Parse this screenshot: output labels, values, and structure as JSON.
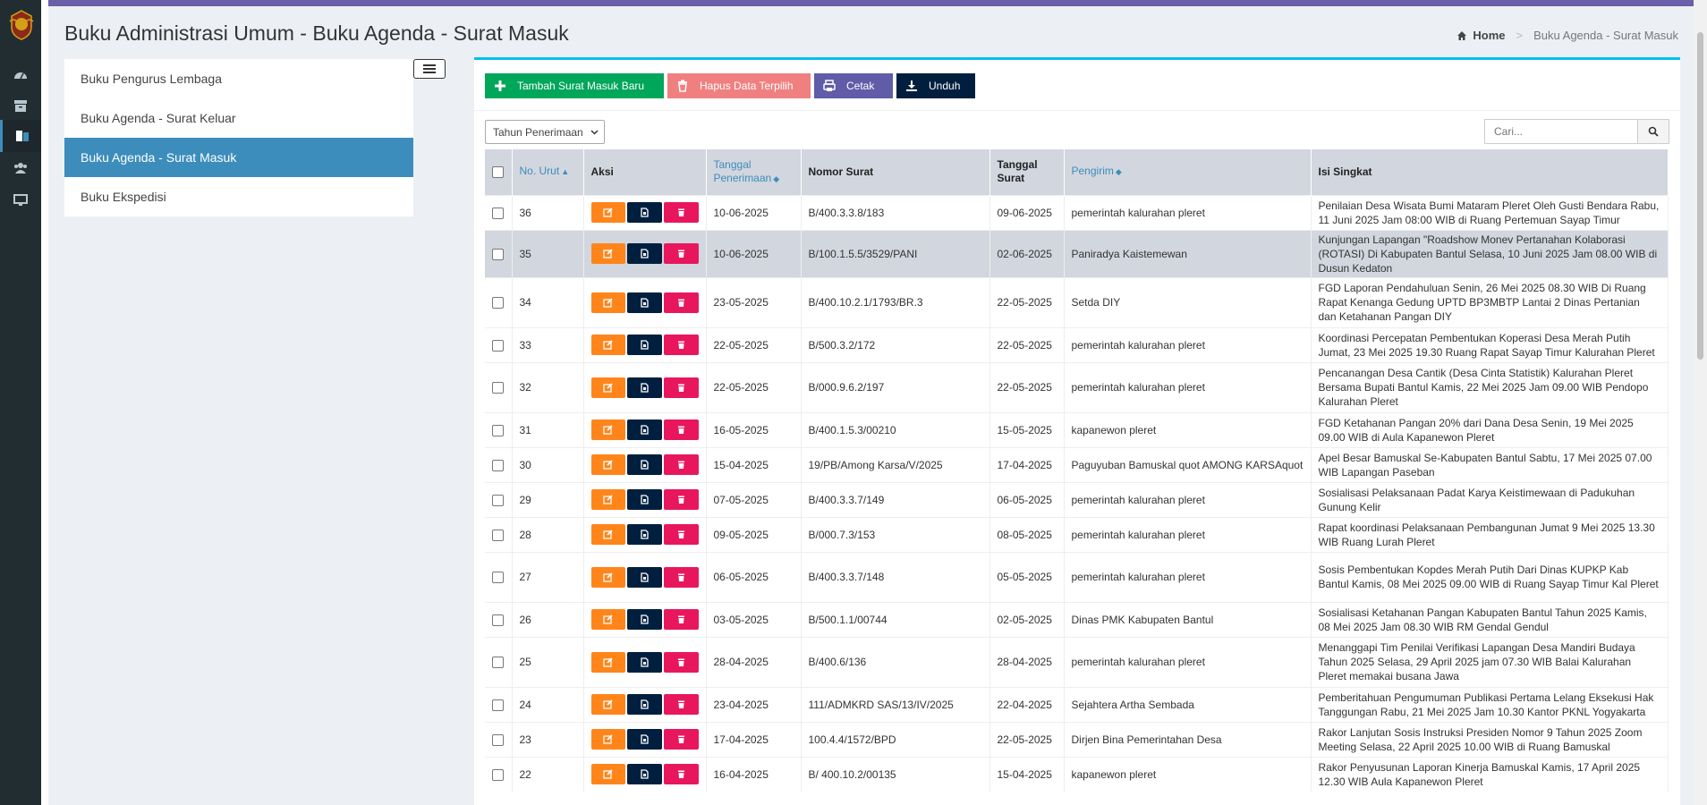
{
  "header": {
    "title": "Buku Administrasi Umum - Buku Agenda - Surat Masuk",
    "breadcrumb_home": "Home",
    "breadcrumb_current": "Buku Agenda - Surat Masuk"
  },
  "menu": {
    "items": [
      {
        "label": "Buku Pengurus Lembaga"
      },
      {
        "label": "Buku Agenda - Surat Keluar"
      },
      {
        "label": "Buku Agenda - Surat Masuk"
      },
      {
        "label": "Buku Ekspedisi"
      }
    ]
  },
  "toolbar": {
    "add_label": "Tambah Surat Masuk Baru",
    "delete_label": "Hapus Data Terpilih",
    "print_label": "Cetak",
    "download_label": "Unduh"
  },
  "filter": {
    "year_value": "Tahun Penerimaan"
  },
  "search": {
    "placeholder": "Cari..."
  },
  "table": {
    "headers": {
      "no": "No. Urut",
      "aksi": "Aksi",
      "tanggal_penerimaan": "Tanggal Penerimaan",
      "nomor_surat": "Nomor Surat",
      "tanggal_surat": "Tanggal Surat",
      "pengirim": "Pengirim",
      "isi": "Isi Singkat"
    },
    "rows": [
      {
        "no": "36",
        "tgl_terima": "10-06-2025",
        "nomor": "B/400.3.3.8/183",
        "tgl_surat": "09-06-2025",
        "pengirim": "pemerintah kalurahan pleret",
        "isi": "Penilaian Desa Wisata Bumi Mataram Pleret Oleh Gusti Bendara Rabu, 11 Juni 2025 Jam 08:00 WIB di Ruang Pertemuan Sayap Timur"
      },
      {
        "no": "35",
        "tgl_terima": "10-06-2025",
        "nomor": "B/100.1.5.5/3529/PANI",
        "tgl_surat": "02-06-2025",
        "pengirim": "Paniradya Kaistemewan",
        "isi": "Kunjungan Lapangan \"Roadshow Monev Pertanahan Kolaborasi (ROTASI) Di Kabupaten Bantul Selasa, 10 Juni 2025 Jam 08.00 WIB di Dusun Kedaton"
      },
      {
        "no": "34",
        "tgl_terima": "23-05-2025",
        "nomor": "B/400.10.2.1/1793/BR.3",
        "tgl_surat": "22-05-2025",
        "pengirim": "Setda DIY",
        "isi": "FGD Laporan Pendahuluan Senin, 26 Mei 2025 08.30 WIB Di Ruang Rapat Kenanga Gedung UPTD BP3MBTP Lantai 2 Dinas Pertanian dan Ketahanan Pangan DIY"
      },
      {
        "no": "33",
        "tgl_terima": "22-05-2025",
        "nomor": "B/500.3.2/172",
        "tgl_surat": "22-05-2025",
        "pengirim": "pemerintah kalurahan pleret",
        "isi": "Koordinasi Percepatan Pembentukan Koperasi Desa Merah Putih Jumat, 23 Mei 2025 19.30 Ruang Rapat Sayap Timur Kalurahan Pleret"
      },
      {
        "no": "32",
        "tgl_terima": "22-05-2025",
        "nomor": "B/000.9.6.2/197",
        "tgl_surat": "22-05-2025",
        "pengirim": "pemerintah kalurahan pleret",
        "isi": "Pencanangan Desa Cantik (Desa Cinta Statistik) Kalurahan Pleret Bersama Bupati Bantul Kamis, 22 Mei 2025 Jam 09.00 WIB Pendopo Kalurahan Pleret"
      },
      {
        "no": "31",
        "tgl_terima": "16-05-2025",
        "nomor": "B/400.1.5.3/00210",
        "tgl_surat": "15-05-2025",
        "pengirim": "kapanewon pleret",
        "isi": "FGD Ketahanan Pangan 20% dari Dana Desa Senin, 19 Mei 2025 09.00 WIB di Aula Kapanewon Pleret"
      },
      {
        "no": "30",
        "tgl_terima": "15-04-2025",
        "nomor": "19/PB/Among Karsa/V/2025",
        "tgl_surat": "17-04-2025",
        "pengirim": "Paguyuban Bamuskal quot AMONG KARSAquot",
        "isi": "Apel Besar Bamuskal Se-Kabupaten Bantul Sabtu, 17 Mei 2025 07.00 WIB Lapangan Paseban"
      },
      {
        "no": "29",
        "tgl_terima": "07-05-2025",
        "nomor": "B/400.3.3.7/149",
        "tgl_surat": "06-05-2025",
        "pengirim": "pemerintah kalurahan pleret",
        "isi": "Sosialisasi Pelaksanaan Padat Karya Keistimewaan di Padukuhan Gunung Kelir"
      },
      {
        "no": "28",
        "tgl_terima": "09-05-2025",
        "nomor": "B/000.7.3/153",
        "tgl_surat": "08-05-2025",
        "pengirim": "pemerintah kalurahan pleret",
        "isi": "Rapat koordinasi Pelaksanaan Pembangunan Jumat 9 Mei 2025 13.30 WIB Ruang Lurah Pleret"
      },
      {
        "no": "27",
        "tgl_terima": "06-05-2025",
        "nomor": "B/400.3.3.7/148",
        "tgl_surat": "05-05-2025",
        "pengirim": "pemerintah kalurahan pleret",
        "isi": "Sosis Pembentukan Kopdes Merah Putih Dari Dinas KUPKP Kab Bantul Kamis, 08 Mei 2025 09.00 WIB di Ruang Sayap Timur Kal Pleret"
      },
      {
        "no": "26",
        "tgl_terima": "03-05-2025",
        "nomor": "B/500.1.1/00744",
        "tgl_surat": "02-05-2025",
        "pengirim": "Dinas PMK Kabupaten Bantul",
        "isi": "Sosialisasi Ketahanan Pangan Kabupaten Bantul Tahun 2025 Kamis, 08 Mei 2025 Jam 08.30 WIB RM Gendal Gendul"
      },
      {
        "no": "25",
        "tgl_terima": "28-04-2025",
        "nomor": "B/400.6/136",
        "tgl_surat": "28-04-2025",
        "pengirim": "pemerintah kalurahan pleret",
        "isi": "Menanggapi Tim Penilai Verifikasi Lapangan Desa Mandiri Budaya Tahun 2025 Selasa, 29 April 2025 jam 07.30 WIB Balai Kalurahan Pleret memakai busana Jawa"
      },
      {
        "no": "24",
        "tgl_terima": "23-04-2025",
        "nomor": "111/ADMKRD SAS/13/IV/2025",
        "tgl_surat": "22-04-2025",
        "pengirim": "Sejahtera Artha Sembada",
        "isi": "Pemberitahuan Pengumuman Publikasi Pertama Lelang Eksekusi Hak Tanggungan Rabu, 21 Mei 2025 Jam 10.30 Kantor PKNL Yogyakarta"
      },
      {
        "no": "23",
        "tgl_terima": "17-04-2025",
        "nomor": "100.4.4/1572/BPD",
        "tgl_surat": "22-05-2025",
        "pengirim": "Dirjen Bina Pemerintahan Desa",
        "isi": "Rakor Lanjutan Sosis Instruksi Presiden Nomor 9 Tahun 2025 Zoom Meeting Selasa, 22 April 2025 10.00 WIB di Ruang Bamuskal"
      },
      {
        "no": "22",
        "tgl_terima": "16-04-2025",
        "nomor": "B/ 400.10.2/00135",
        "tgl_surat": "15-04-2025",
        "pengirim": "kapanewon pleret",
        "isi": "Rakor Penyusunan Laporan Kinerja Bamuskal Kamis, 17 April 2025 12.30 WIB Aula Kapanewon Pleret"
      }
    ]
  }
}
